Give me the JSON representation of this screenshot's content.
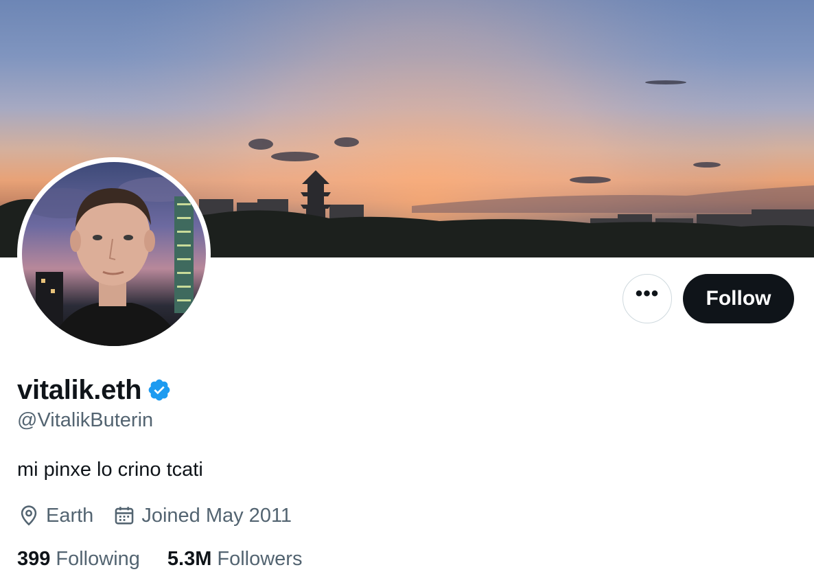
{
  "profile": {
    "display_name": "vitalik.eth",
    "handle": "@VitalikButerin",
    "bio": "mi pinxe lo crino tcati",
    "location": "Earth",
    "joined": "Joined May 2011",
    "verified": true
  },
  "actions": {
    "more_label": "•••",
    "follow_label": "Follow"
  },
  "stats": {
    "following_count": "399",
    "following_label": "Following",
    "followers_count": "5.3M",
    "followers_label": "Followers"
  },
  "icons": {
    "location": "location-pin-icon",
    "joined": "calendar-icon",
    "verified": "verified-badge-icon"
  },
  "colors": {
    "text_primary": "#0f1419",
    "text_secondary": "#536471",
    "verified_blue": "#1d9bf0",
    "follow_bg": "#0f1419"
  }
}
